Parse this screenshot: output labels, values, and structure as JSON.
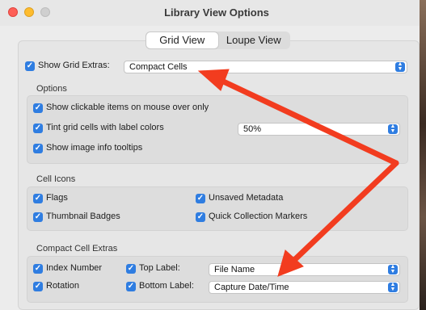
{
  "window": {
    "title": "Library View Options"
  },
  "tabs": [
    {
      "label": "Grid View",
      "active": true
    },
    {
      "label": "Loupe View",
      "active": false
    }
  ],
  "grid_extras": {
    "label": "Show Grid Extras:",
    "checked": true,
    "value": "Compact Cells"
  },
  "options": {
    "title": "Options",
    "items": [
      {
        "label": "Show clickable items on mouse over only",
        "checked": true
      },
      {
        "label": "Tint grid cells with label colors",
        "checked": true,
        "select_value": "50%"
      },
      {
        "label": "Show image info tooltips",
        "checked": true
      }
    ]
  },
  "cell_icons": {
    "title": "Cell Icons",
    "items": [
      {
        "label": "Flags",
        "checked": true
      },
      {
        "label": "Unsaved Metadata",
        "checked": true
      },
      {
        "label": "Thumbnail Badges",
        "checked": true
      },
      {
        "label": "Quick Collection Markers",
        "checked": true
      }
    ]
  },
  "compact_cell_extras": {
    "title": "Compact Cell Extras",
    "index_number": {
      "label": "Index Number",
      "checked": true
    },
    "rotation": {
      "label": "Rotation",
      "checked": true
    },
    "top_label": {
      "label": "Top Label:",
      "checked": true,
      "value": "File Name"
    },
    "bottom_label": {
      "label": "Bottom Label:",
      "checked": true,
      "value": "Capture Date/Time"
    }
  },
  "colors": {
    "accent": "#2f7de1",
    "arrow": "#f23c1f"
  }
}
